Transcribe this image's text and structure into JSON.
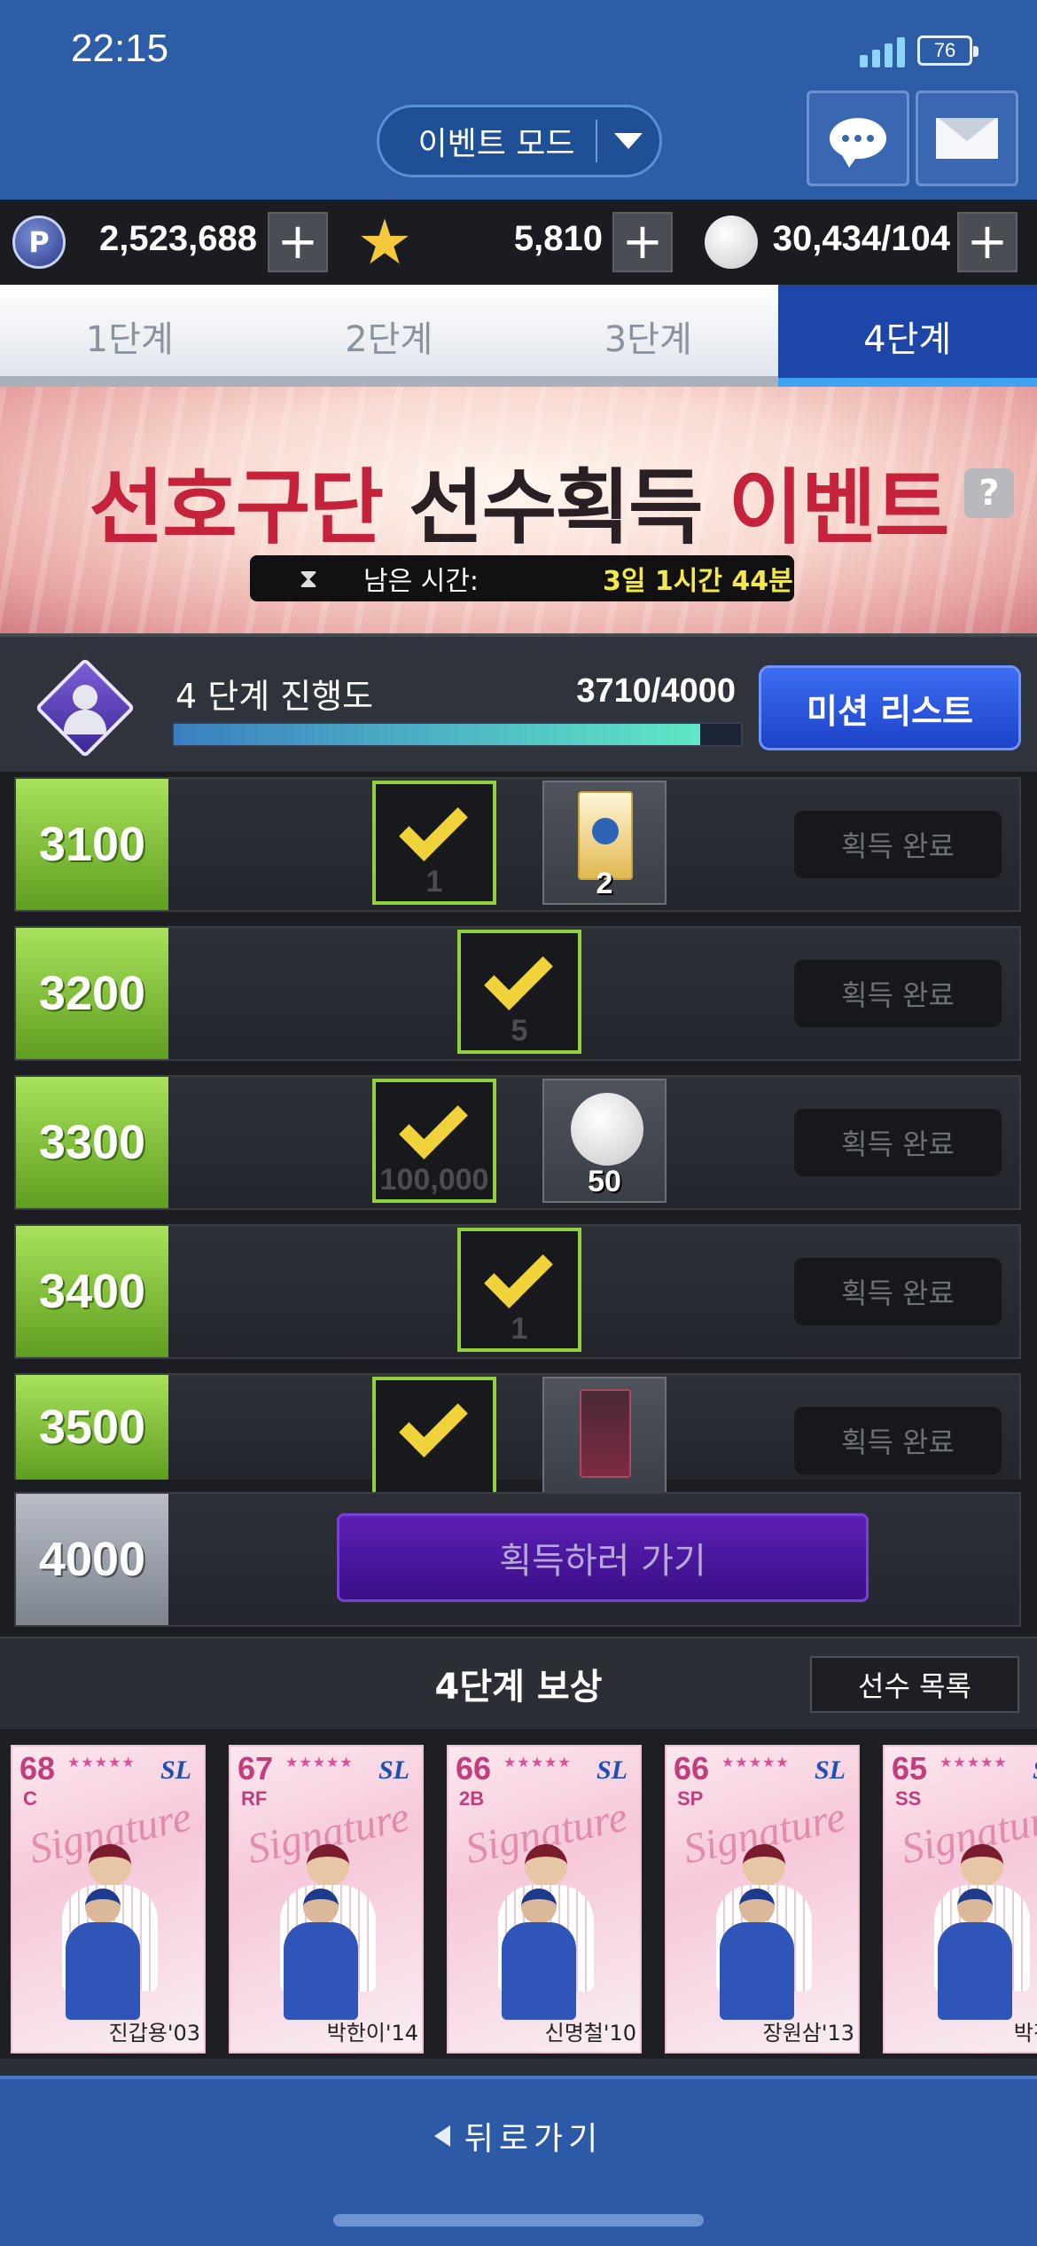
{
  "status_bar": {
    "time": "22:15",
    "battery": "76"
  },
  "header": {
    "mode_label": "이벤트 모드"
  },
  "currency": [
    {
      "icon": "p-point-icon",
      "value": "2,523,688"
    },
    {
      "icon": "star-icon",
      "value": "5,810"
    },
    {
      "icon": "baseball-icon",
      "value": "30,434/104"
    }
  ],
  "tabs": [
    {
      "label": "1단계",
      "active": false
    },
    {
      "label": "2단계",
      "active": false
    },
    {
      "label": "3단계",
      "active": false
    },
    {
      "label": "4단계",
      "active": true
    }
  ],
  "banner": {
    "title_part1": "선호구단",
    "title_part2": "선수획득",
    "title_part3": "이벤트",
    "help_label": "?",
    "timer_label": "남은 시간:",
    "timer_value": "3일 1시간 44분"
  },
  "progress": {
    "label": "4 단계 진행도",
    "count": "3710/4000",
    "fraction": 0.9275,
    "mission_button": "미션 리스트"
  },
  "rewards": [
    {
      "threshold": "3100",
      "items": [
        {
          "type": "claimed",
          "qty": "1"
        },
        {
          "type": "pack",
          "qty": "2"
        }
      ],
      "status": "획득 완료"
    },
    {
      "threshold": "3200",
      "items": [
        {
          "type": "claimed",
          "qty": "5"
        }
      ],
      "status": "획득 완료"
    },
    {
      "threshold": "3300",
      "items": [
        {
          "type": "claimed",
          "qty": "100,000"
        },
        {
          "type": "ball",
          "qty": "50"
        }
      ],
      "status": "획득 완료"
    },
    {
      "threshold": "3400",
      "items": [
        {
          "type": "claimed",
          "qty": "1"
        }
      ],
      "status": "획득 완료"
    },
    {
      "threshold": "3500",
      "items": [
        {
          "type": "claimed",
          "qty": ""
        },
        {
          "type": "ticket",
          "qty": ""
        }
      ],
      "status": "획득 완료"
    }
  ],
  "final_reward": {
    "threshold": "4000",
    "button": "획득하러 가기"
  },
  "stage_reward": {
    "title": "4단계 보상",
    "list_button": "선수 목록",
    "cards": [
      {
        "ovr": "68",
        "pos": "C",
        "name": "진갑용'03",
        "badge": "SL"
      },
      {
        "ovr": "67",
        "pos": "RF",
        "name": "박한이'14",
        "badge": "SL"
      },
      {
        "ovr": "66",
        "pos": "2B",
        "name": "신명철'10",
        "badge": "SL"
      },
      {
        "ovr": "66",
        "pos": "SP",
        "name": "장원삼'13",
        "badge": "SL"
      },
      {
        "ovr": "65",
        "pos": "SS",
        "name": "박진만",
        "badge": "SL"
      }
    ],
    "card_script": "Signature",
    "card_stars": "★★★★★"
  },
  "footer": {
    "back_label": "뒤로가기"
  }
}
